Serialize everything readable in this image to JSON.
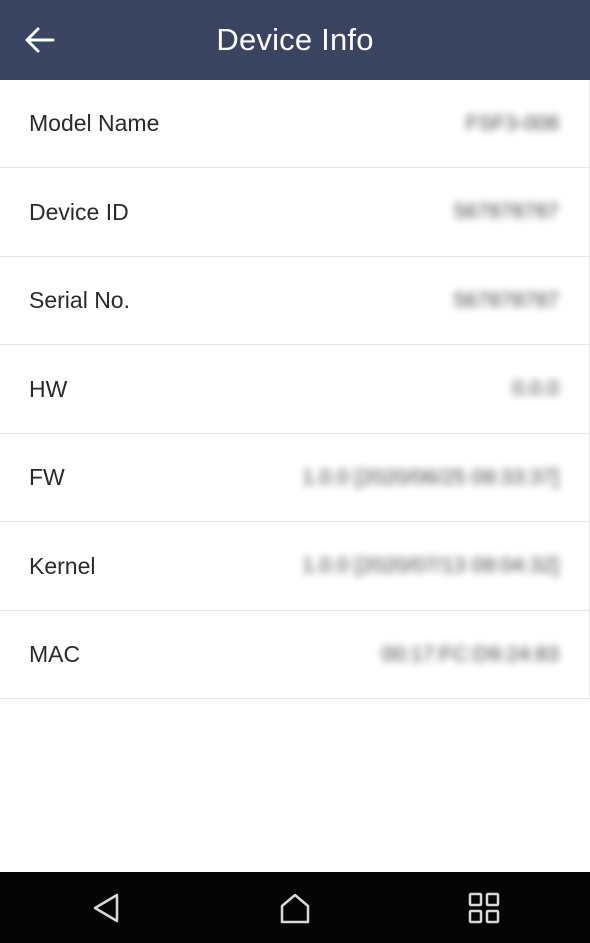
{
  "header": {
    "title": "Device Info",
    "back_icon": "arrow-left-icon"
  },
  "rows": [
    {
      "label": "Model Name",
      "value": "FSF3-008"
    },
    {
      "label": "Device ID",
      "value": "567878787"
    },
    {
      "label": "Serial No.",
      "value": "567878787"
    },
    {
      "label": "HW",
      "value": "0.0.0"
    },
    {
      "label": "FW",
      "value": "1.0.0 [2020/06/25 09:33:37]"
    },
    {
      "label": "Kernel",
      "value": "1.0.0 [2020/07/13 09:04:32]"
    },
    {
      "label": "MAC",
      "value": "00:17:FC:D9:24:83"
    }
  ],
  "navbar": {
    "back_icon": "triangle-back-icon",
    "home_icon": "home-icon",
    "recent_icon": "grid-apps-icon"
  },
  "colors": {
    "header_bg": "#3a4461",
    "navbar_bg": "#050505",
    "divider": "#e6e6e6"
  }
}
